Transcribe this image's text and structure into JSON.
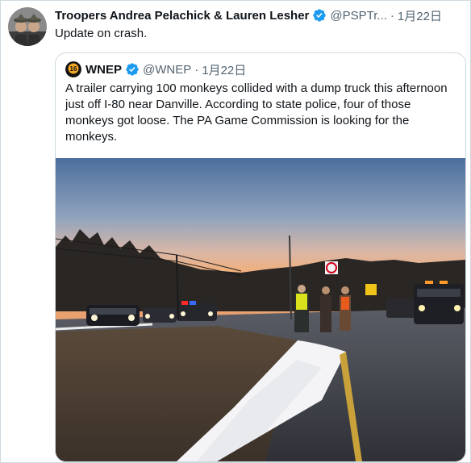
{
  "tweet": {
    "author_name": "Troopers Andrea Pelachick & Lauren Lesher",
    "handle": "@PSPTr...",
    "separator": "·",
    "time": "1月22日",
    "text": "Update on crash.",
    "avatar_icon": "troopers-avatar",
    "verified_icon": "verified-badge-icon"
  },
  "quoted_tweet": {
    "author_name": "WNEP",
    "handle": "@WNEP",
    "separator": "·",
    "time": "1月22日",
    "text": "A trailer carrying 100 monkeys collided with a dump truck this afternoon just off I-80 near Danville. According to state police, four of those monkeys got loose. The PA Game Commission is looking for the monkeys.",
    "avatar_icon": "wnep-logo",
    "verified_icon": "verified-badge-icon",
    "media_icon": "crash-scene-photo"
  },
  "colors": {
    "text_primary": "#0f1419",
    "text_secondary": "#536471",
    "border": "#cfd9de",
    "verified_blue": "#1d9bf0"
  }
}
